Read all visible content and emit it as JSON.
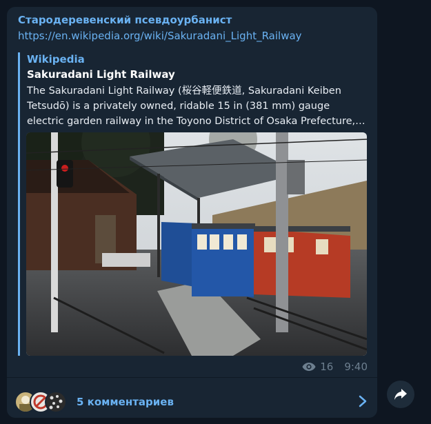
{
  "post": {
    "channel_name": "Стародеревенский псевдоурбанист",
    "link": "https://en.wikipedia.org/wiki/Sakuradani_Light_Railway"
  },
  "preview": {
    "site_name": "Wikipedia",
    "title": "Sakuradani Light Railway",
    "description": "The Sakuradani Light Railway (桜谷軽便鉄道, Sakuradani Keiben Tetsudō) is a privately owned, ridable 15 in (381 mm) gauge electric garden railway in the Toyono District of Osaka Prefecture, Japan.",
    "image_icon": "photo-icon"
  },
  "meta": {
    "views": "16",
    "time": "9:40",
    "views_icon": "eye-icon"
  },
  "comments": {
    "label": "5 комментариев",
    "avatars_shown": 3,
    "chevron_icon": "chevron-right-icon"
  },
  "share": {
    "icon": "share-arrow-icon"
  },
  "colors": {
    "background": "#0e1621",
    "bubble": "#182533",
    "accent": "#6ab2f2",
    "text": "#e9eef4",
    "muted": "#6d7f8f"
  }
}
